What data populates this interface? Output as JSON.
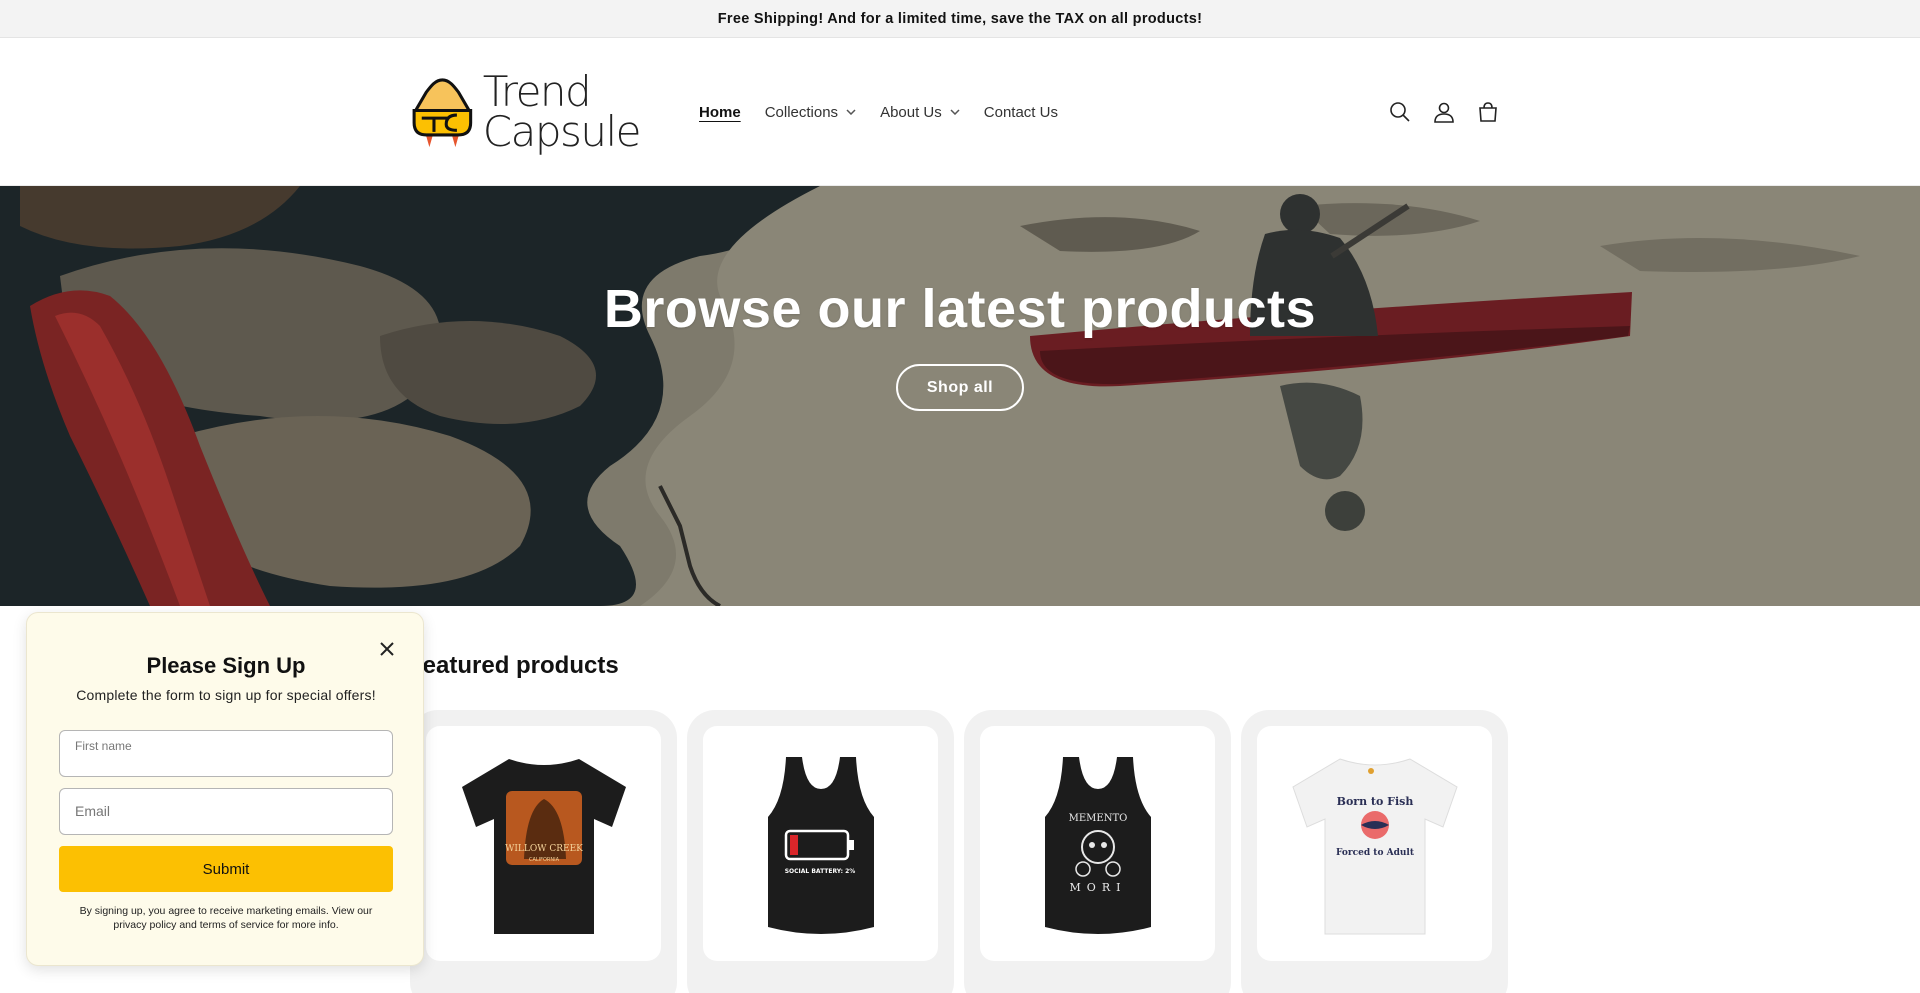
{
  "announcement": {
    "text": "Free Shipping! And for a limited time, save the TAX on all products!"
  },
  "brand": {
    "line1": "Trend",
    "line2": "Capsule",
    "logo_icon": "capsule-rocket-logo",
    "accent": "#fcc002"
  },
  "nav": {
    "items": [
      {
        "label": "Home",
        "active": true
      },
      {
        "label": "Collections",
        "dropdown": true
      },
      {
        "label": "About Us",
        "dropdown": true
      },
      {
        "label": "Contact Us"
      }
    ]
  },
  "header_icons": [
    "search-icon",
    "account-icon",
    "cart-icon"
  ],
  "hero": {
    "title": "Browse our latest products",
    "button_label": "Shop all"
  },
  "featured": {
    "title": "Featured products",
    "products": [
      {
        "image": "black-tshirt-willow-creek-bigfoot"
      },
      {
        "image": "black-tank-social-battery"
      },
      {
        "image": "black-tank-memento-mori"
      },
      {
        "image": "white-tshirt-born-to-fish"
      }
    ]
  },
  "popup": {
    "title": "Please Sign Up",
    "subtitle": "Complete the form to sign up for special offers!",
    "first_name_label": "First name",
    "email_placeholder": "Email",
    "submit_label": "Submit",
    "legal": "By signing up, you agree to receive marketing emails. View our privacy policy and terms of service for more info.",
    "colors": {
      "background": "#fefbea",
      "button": "#fcc002"
    }
  },
  "product_art_text": {
    "p1_line1": "WILLOW CREEK",
    "p1_line2": "CALIFORNIA",
    "p2_text": "SOCIAL BATTERY: 2%",
    "p3_top": "MEMENTO",
    "p3_bottom": "MORI",
    "p4_top": "Born to Fish",
    "p4_bottom": "Forced to Adult"
  }
}
